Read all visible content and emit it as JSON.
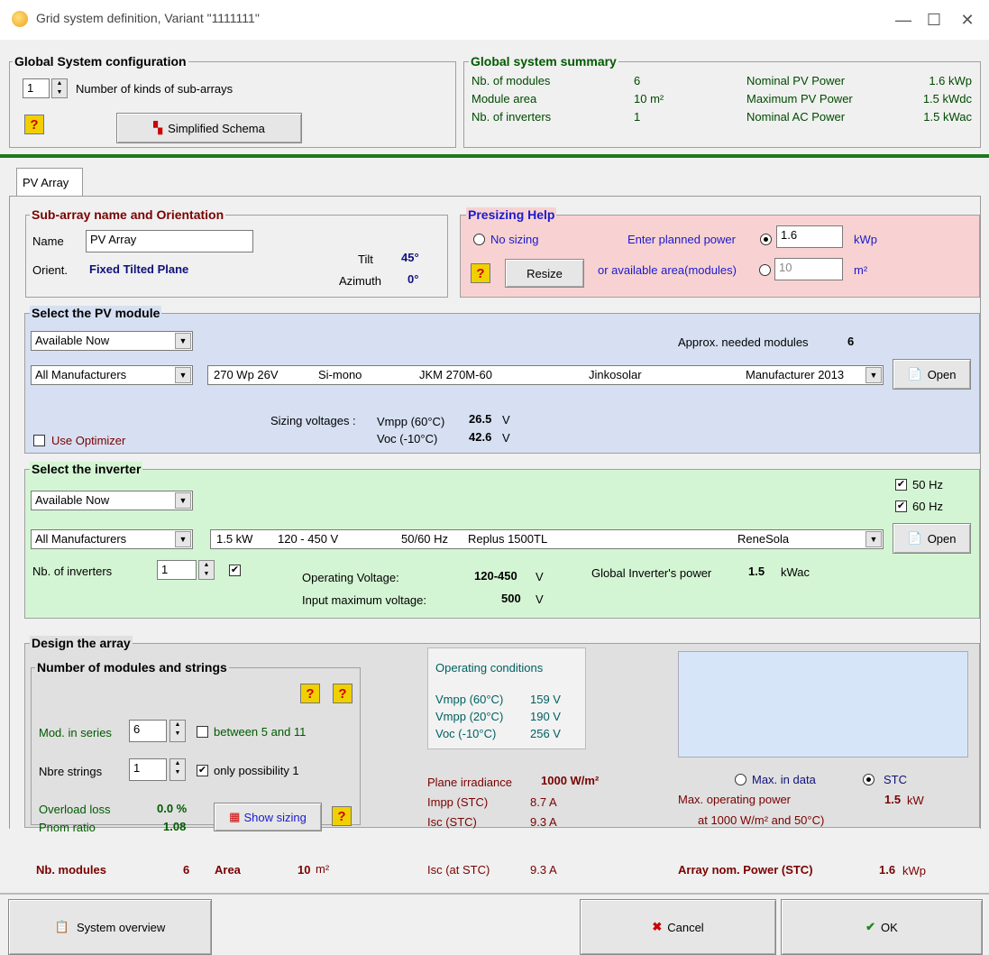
{
  "window": {
    "title": "Grid system definition, Variant  \"1111111\""
  },
  "global_config": {
    "title": "Global System configuration",
    "kinds_value": "1",
    "kinds_label": "Number of kinds of sub-arrays",
    "schema_button": "Simplified Schema"
  },
  "summary": {
    "title": "Global system summary",
    "rows": [
      {
        "label": "Nb. of modules",
        "value": "6",
        "label2": "Nominal PV Power",
        "value2": "1.6  kWp"
      },
      {
        "label": "Module area",
        "value": "10 m²",
        "label2": "Maximum PV Power",
        "value2": "1.5  kWdc"
      },
      {
        "label": "Nb. of inverters",
        "value": "1",
        "label2": "Nominal AC Power",
        "value2": "1.5  kWac"
      }
    ]
  },
  "tab": {
    "label": "PV Array"
  },
  "subarray": {
    "title": "Sub-array name and Orientation",
    "name_label": "Name",
    "name_value": "PV Array",
    "orient_label": "Orient.",
    "orient_value": "Fixed Tilted Plane",
    "tilt_label": "Tilt",
    "tilt_value": "45°",
    "azimuth_label": "Azimuth",
    "azimuth_value": "0°"
  },
  "presizing": {
    "title": "Presizing Help",
    "no_sizing": "No sizing",
    "planned_label": "Enter planned power",
    "planned_value": "1.6",
    "planned_unit": "kWp",
    "resize": "Resize",
    "area_label": "or available area(modules)",
    "area_value": "10",
    "area_unit": "m²"
  },
  "module": {
    "title": "Select the PV module",
    "availability": "Available Now",
    "approx_label": "Approx. needed modules",
    "approx_value": "6",
    "manufacturers": "All Manufacturers",
    "sel_power": "270 Wp 26V",
    "sel_tech": "Si-mono",
    "sel_model": "JKM 270M-60",
    "sel_brand": "Jinkosolar",
    "sel_source": "Manufacturer 2013",
    "open": "Open",
    "sizing_label": "Sizing voltages :",
    "vmpp_label": "Vmpp (60°C)",
    "vmpp_value": "26.5",
    "voc_label": "Voc  (-10°C)",
    "voc_value": "42.6",
    "volt_unit": "V",
    "optimizer": "Use Optimizer"
  },
  "inverter": {
    "title": "Select the inverter",
    "hz50": "50 Hz",
    "hz60": "60 Hz",
    "availability": "Available Now",
    "manufacturers": "All Manufacturers",
    "sel_power": "1.5 kW",
    "sel_range": "120 - 450 V",
    "sel_freq": "50/60 Hz",
    "sel_model": "Replus 1500TL",
    "sel_brand": "ReneSola",
    "open": "Open",
    "nb_label": "Nb. of inverters",
    "nb_value": "1",
    "op_label": "Operating Voltage:",
    "op_value": "120-450",
    "in_label": "Input maximum voltage:",
    "in_value": "500",
    "volt_unit": "V",
    "global_label": "Global Inverter's power",
    "global_value": "1.5",
    "global_unit": "kWac"
  },
  "design": {
    "title": "Design the array",
    "strings_title": "Number of modules and strings",
    "series_label": "Mod. in series",
    "series_value": "6",
    "series_hint": "between 5 and 11",
    "strings_label": "Nbre strings",
    "strings_value": "1",
    "strings_hint": "only possibility 1",
    "overload_label": "Overload loss",
    "overload_value": "0.0 %",
    "pnom_label": "Pnom ratio",
    "pnom_value": "1.08",
    "show_sizing": "Show sizing",
    "nbmod_label": "Nb. modules",
    "nbmod_value": "6",
    "area_label": "Area",
    "area_value": "10",
    "area_unit": "m²",
    "opcond_title": "Operating conditions",
    "opcond": [
      {
        "label": "Vmpp (60°C)",
        "value": "159  V"
      },
      {
        "label": "Vmpp (20°C)",
        "value": "190  V"
      },
      {
        "label": "Voc  (-10°C)",
        "value": "256  V"
      }
    ],
    "irr_label": "Plane irradiance",
    "irr_value": "1000 W/m²",
    "impp_label": "Impp (STC)",
    "impp_value": "8.7 A",
    "isc_label": "Isc  (STC)",
    "isc_value": "9.3 A",
    "isc2_label": "Isc (at STC)",
    "isc2_value": "9.3 A",
    "max_data": "Max. in data",
    "stc": "STC",
    "maxop_label": "Max. operating power",
    "maxop_sub": "at 1000 W/m² and 50°C)",
    "maxop_value": "1.5",
    "maxop_unit": "kW",
    "nom_label": "Array nom. Power (STC)",
    "nom_value": "1.6",
    "nom_unit": "kWp"
  },
  "footer": {
    "overview": "System overview",
    "cancel": "Cancel",
    "ok": "OK"
  }
}
